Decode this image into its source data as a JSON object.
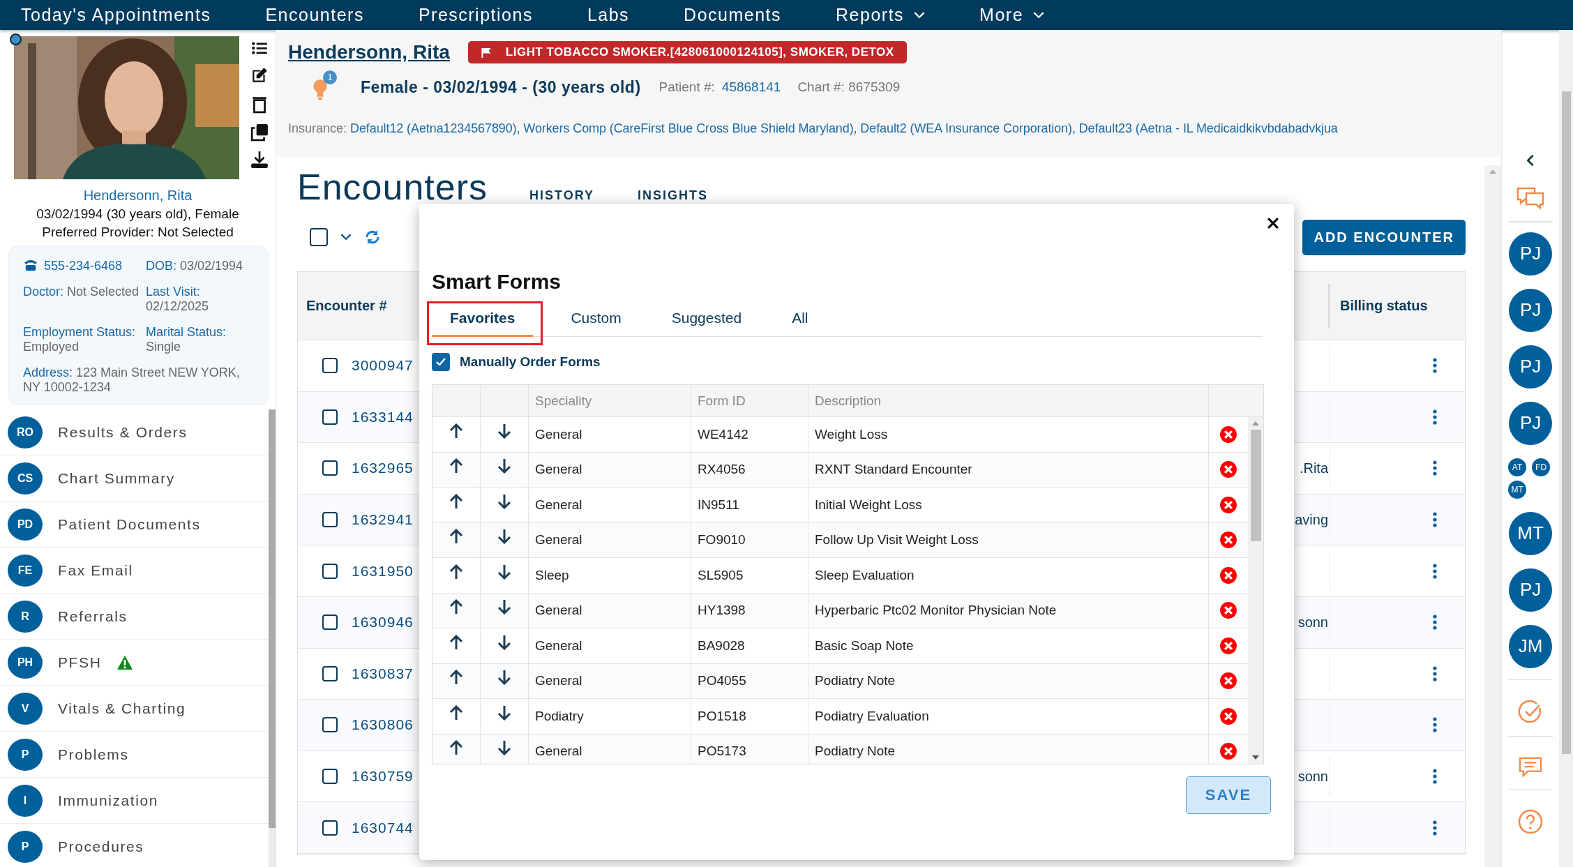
{
  "top_nav": {
    "items": [
      {
        "label": "Today's Appointments",
        "has_menu": false
      },
      {
        "label": "Encounters",
        "has_menu": false
      },
      {
        "label": "Prescriptions",
        "has_menu": false
      },
      {
        "label": "Labs",
        "has_menu": false
      },
      {
        "label": "Documents",
        "has_menu": false
      },
      {
        "label": "Reports",
        "has_menu": true
      },
      {
        "label": "More",
        "has_menu": true
      }
    ]
  },
  "patient_card": {
    "name": "Hendersonn, Rita",
    "details": "03/02/1994 (30 years old), Female",
    "preferred_provider": "Preferred Provider: Not Selected",
    "info": {
      "phone": "555-234-6468",
      "fields": [
        {
          "label": "DOB:",
          "value": "03/02/1994"
        },
        {
          "label": "Doctor:",
          "value": "Not Selected"
        },
        {
          "label": "Last Visit:",
          "value": "02/12/2025"
        },
        {
          "label": "Employment Status:",
          "value": "Employed"
        },
        {
          "label": "Marital Status:",
          "value": "Single"
        },
        {
          "label": "Address:",
          "value": "123 Main Street  NEW YORK, NY 10002-1234"
        }
      ]
    }
  },
  "sidebar": {
    "items": [
      {
        "initials": "RO",
        "label": "Results & Orders",
        "warning": false
      },
      {
        "initials": "CS",
        "label": "Chart Summary",
        "warning": false
      },
      {
        "initials": "PD",
        "label": "Patient Documents",
        "warning": false
      },
      {
        "initials": "FE",
        "label": "Fax Email",
        "warning": false
      },
      {
        "initials": "R",
        "label": "Referrals",
        "warning": false
      },
      {
        "initials": "PH",
        "label": "PFSH",
        "warning": true
      },
      {
        "initials": "V",
        "label": "Vitals & Charting",
        "warning": false
      },
      {
        "initials": "P",
        "label": "Problems",
        "warning": false
      },
      {
        "initials": "I",
        "label": "Immunization",
        "warning": false
      },
      {
        "initials": "P",
        "label": "Procedures",
        "warning": false
      }
    ]
  },
  "header": {
    "name": "Hendersonn, Rita",
    "alert_badge": "LIGHT TOBACCO SMOKER.[428061000124105], SMOKER, DETOX",
    "notification_count": "1",
    "summary": "Female - 03/02/1994 - (30 years old)",
    "patient_number_label": "Patient #:",
    "patient_number": "45868141",
    "chart_number": "Chart #: 8675309",
    "insurance_label": "Insurance:",
    "insurance": "Default12 (Aetna1234567890), Workers Comp (CareFirst Blue Cross Blue Shield Maryland), Default2 (WEA Insurance Corporation), Default23 (Aetna - IL Medicaidkikvbdabadvkjua"
  },
  "encounters": {
    "title": "Encounters",
    "tabs": [
      {
        "label": "HISTORY",
        "selected": false
      },
      {
        "label": "INSIGHTS",
        "selected": false
      }
    ],
    "add_button": "ADD ENCOUNTER",
    "select_all": {
      "checked": false
    },
    "table": {
      "columns": [
        "Encounter #",
        "Billing status"
      ],
      "rows": [
        {
          "encounter": "3000947",
          "checked": false
        },
        {
          "encounter": "1633144",
          "checked": false
        },
        {
          "encounter": "1632965",
          "column_2": ".Rita",
          "checked": false
        },
        {
          "encounter": "1632941",
          "column_2": "aving",
          "checked": false
        },
        {
          "encounter": "1631950",
          "checked": false
        },
        {
          "encounter": "1630946",
          "column_2": "sonn",
          "checked": false
        },
        {
          "encounter": "1630837",
          "checked": false
        },
        {
          "encounter": "1630806",
          "checked": false
        },
        {
          "encounter": "1630759",
          "column_2": "sonn",
          "checked": false
        },
        {
          "encounter": "1630744",
          "checked": false
        }
      ]
    }
  },
  "modal": {
    "title": "Smart Forms",
    "tabs": [
      {
        "label": "Favorites",
        "selected": true
      },
      {
        "label": "Custom",
        "selected": false
      },
      {
        "label": "Suggested",
        "selected": false
      },
      {
        "label": "All",
        "selected": false
      }
    ],
    "manual_order": {
      "label": "Manually Order Forms",
      "checked": true
    },
    "columns": [
      "Speciality",
      "Form ID",
      "Description"
    ],
    "rows": [
      {
        "speciality": "General",
        "form_id": "WE4142",
        "description": "Weight Loss"
      },
      {
        "speciality": "General",
        "form_id": "RX4056",
        "description": "RXNT Standard Encounter"
      },
      {
        "speciality": "General",
        "form_id": "IN9511",
        "description": "Initial Weight Loss"
      },
      {
        "speciality": "General",
        "form_id": "FO9010",
        "description": "Follow Up Visit Weight Loss"
      },
      {
        "speciality": "Sleep",
        "form_id": "SL5905",
        "description": "Sleep Evaluation"
      },
      {
        "speciality": "General",
        "form_id": "HY1398",
        "description": "Hyperbaric Ptc02 Monitor Physician Note"
      },
      {
        "speciality": "General",
        "form_id": "BA9028",
        "description": "Basic Soap Note"
      },
      {
        "speciality": "General",
        "form_id": "PO4055",
        "description": "Podiatry Note"
      },
      {
        "speciality": "Podiatry",
        "form_id": "PO1518",
        "description": "Podiatry Evaluation"
      },
      {
        "speciality": "General",
        "form_id": "PO5173",
        "description": "Podiatry Note"
      }
    ],
    "save_button": {
      "label": "SAVE",
      "disabled": true
    }
  },
  "right_rail": {
    "avatars": [
      {
        "initials": "PJ",
        "kind": "large"
      },
      {
        "initials": "PJ",
        "kind": "large"
      },
      {
        "initials": "PJ",
        "kind": "large"
      },
      {
        "initials": "PJ",
        "kind": "large"
      },
      {
        "initials": "AT",
        "kind": "small"
      },
      {
        "initials": "FD",
        "kind": "small"
      },
      {
        "initials": "MT",
        "kind": "small"
      },
      {
        "initials": "MT",
        "kind": "large"
      },
      {
        "initials": "PJ",
        "kind": "large"
      },
      {
        "initials": "JM",
        "kind": "large"
      }
    ]
  }
}
